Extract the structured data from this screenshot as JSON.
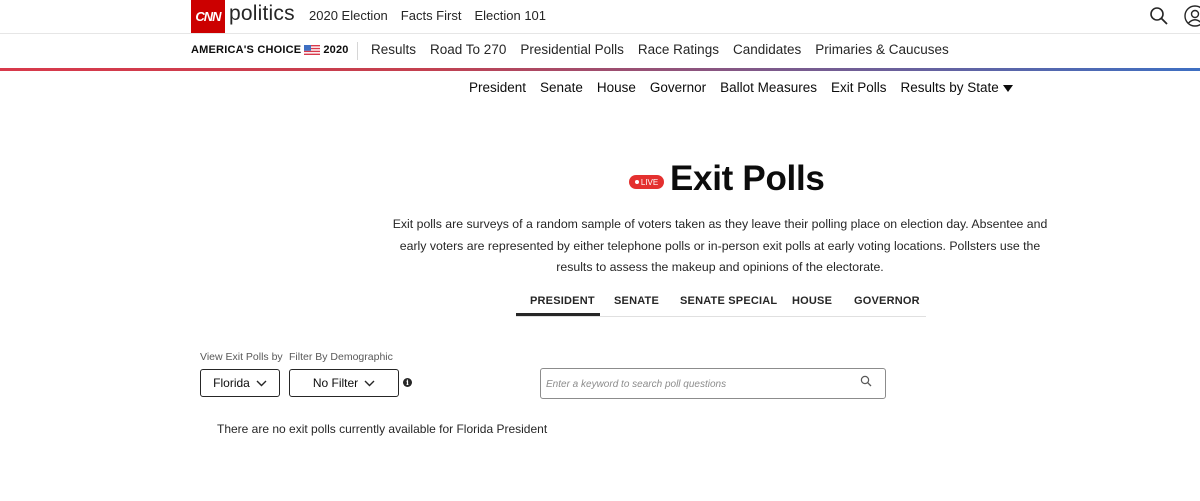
{
  "header": {
    "logo_text": "CNN",
    "brand": "politics",
    "nav": [
      "2020 Election",
      "Facts First",
      "Election 101"
    ]
  },
  "election_bar": {
    "label": "AMERICA'S CHOICE",
    "year": "2020",
    "nav": [
      "Results",
      "Road To 270",
      "Presidential Polls",
      "Race Ratings",
      "Candidates",
      "Primaries & Caucuses"
    ]
  },
  "subnav": {
    "items": [
      "President",
      "Senate",
      "House",
      "Governor",
      "Ballot Measures",
      "Exit Polls"
    ],
    "dropdown_label": "Results by State"
  },
  "main": {
    "live_badge": "LIVE",
    "title": "Exit Polls",
    "description": "Exit polls are surveys of a random sample of voters taken as they leave their polling place on election day. Absentee and early voters are represented by either telephone polls or in-person exit polls at early voting locations. Pollsters use the results to assess the makeup and opinions of the electorate.",
    "tabs": [
      "PRESIDENT",
      "SENATE",
      "SENATE SPECIAL",
      "HOUSE",
      "GOVERNOR"
    ],
    "active_tab": "PRESIDENT"
  },
  "filters": {
    "view_label": "View Exit Polls by",
    "view_value": "Florida",
    "demographic_label": "Filter By Demographic",
    "demographic_value": "No Filter",
    "search_placeholder": "Enter a keyword to search poll questions"
  },
  "empty_message": "There are no exit polls currently available for Florida President",
  "colors": {
    "cnn_red": "#cc0000",
    "live_red": "#e4302f",
    "gradient_red": "#d8394b",
    "gradient_blue": "#3e6fc2"
  }
}
